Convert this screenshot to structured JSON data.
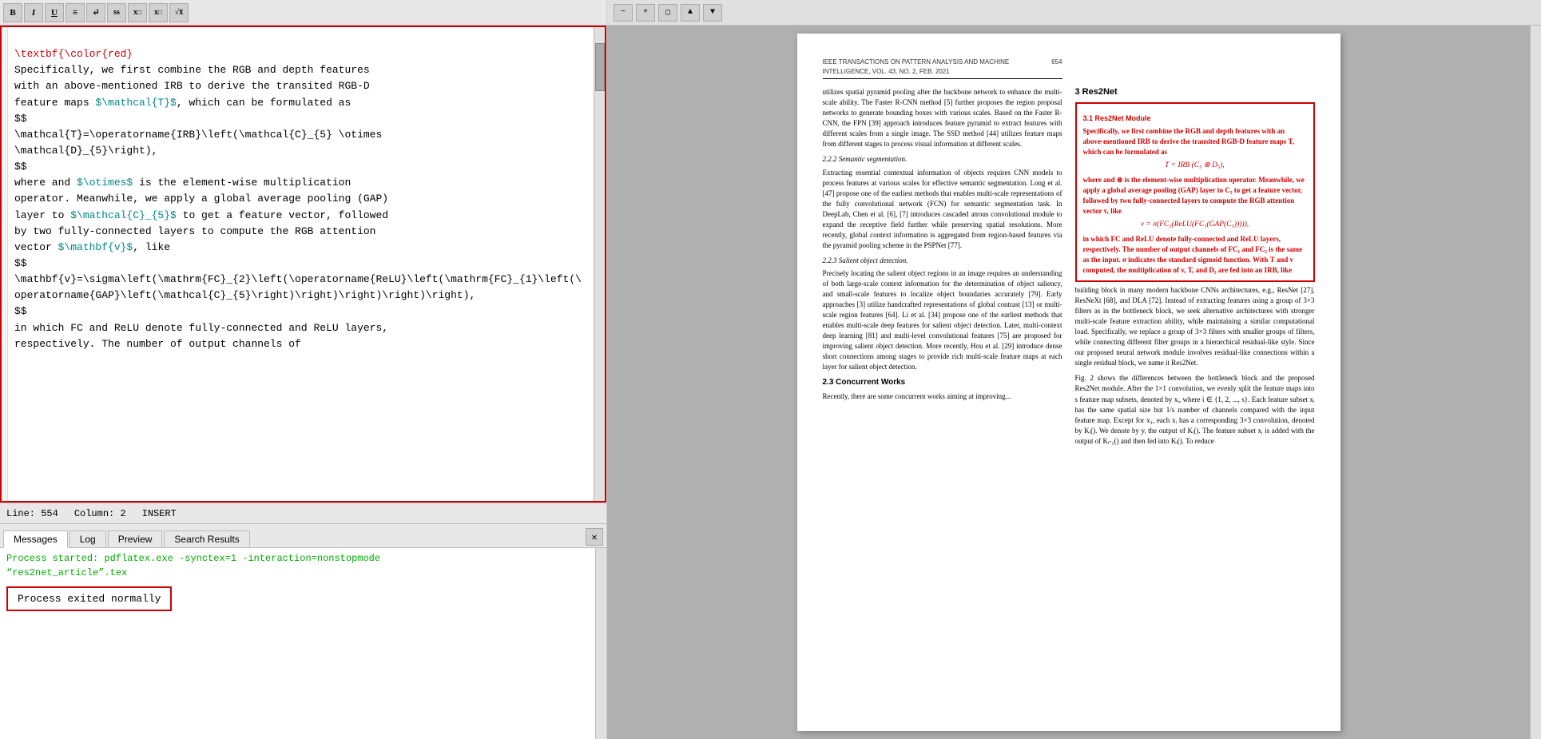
{
  "editor": {
    "toolbar_buttons": [
      "B",
      "I",
      "U",
      "align",
      "enter",
      "ss",
      "x_sub",
      "x_sup",
      "fx"
    ],
    "content_lines": [
      {
        "type": "keyword-red",
        "text": "\\textbf{\\color{red}"
      },
      {
        "type": "normal",
        "text": "Specifically, we first combine the RGB and depth features"
      },
      {
        "type": "normal",
        "text": "with an above-mentioned IRB to derive the transited RGB-D"
      },
      {
        "type": "normal",
        "text": "feature maps "
      },
      {
        "type": "inline",
        "parts": [
          {
            "type": "normal",
            "text": "feature maps "
          },
          {
            "type": "cyan",
            "text": "$\\mathcal{T}$"
          },
          {
            "type": "normal",
            "text": ", which can be formulated as"
          }
        ]
      },
      {
        "type": "normal",
        "text": "$$"
      },
      {
        "type": "normal",
        "text": "\\mathcal{T}=\\operatorname{IRB}\\left(\\mathcal{C}_{5} \\otimes"
      },
      {
        "type": "normal",
        "text": "\\mathcal{D}_{5}\\right),"
      },
      {
        "type": "normal",
        "text": "$$"
      },
      {
        "type": "normal",
        "text": "where and "
      },
      {
        "type": "inline2",
        "text": "where and $\\otimes$ is the element-wise multiplication"
      },
      {
        "type": "normal",
        "text": "operator. Meanwhile, we apply a global average pooling (GAP)"
      },
      {
        "type": "inline3",
        "text": "layer to $\\mathcal{C}_{5}$ to get a feature vector, followed"
      },
      {
        "type": "normal",
        "text": "by two fully-connected layers to compute the RGB attention"
      },
      {
        "type": "inline4",
        "text": "vector $\\mathbf{v}$, like"
      },
      {
        "type": "normal",
        "text": "$$"
      },
      {
        "type": "normal",
        "text": "\\mathbf{v}=\\sigma\\left(\\mathrm{FC}_{2}\\left(\\operatorname{ReLU}\\left(\\mathrm{FC}_{1}\\left(\\operatorname{GAP}\\left(\\mathcal{C}_{5}\\right)\\right)\\right)\\right)\\right),"
      },
      {
        "type": "normal",
        "text": "$$"
      },
      {
        "type": "normal",
        "text": "in which FC and ReLU denote fully-connected and ReLU layers,"
      },
      {
        "type": "normal",
        "text": "respectively. The number of output channels of"
      }
    ],
    "status_line": "Line: 554    Column: 2         INSERT",
    "status_line_num": "Line: 554",
    "status_col": "Column: 2",
    "status_mode": "INSERT"
  },
  "messages_panel": {
    "tabs": [
      "Messages",
      "Log",
      "Preview",
      "Search Results"
    ],
    "active_tab": "Messages",
    "process_line1": "Process started: pdflatex.exe -synctex=1 -interaction=nonstopmode",
    "process_line2": "“res2net_article”.tex",
    "exited_text": "Process exited normally"
  },
  "pdf": {
    "header_left": "IEEE TRANSACTIONS ON PATTERN ANALYSIS AND MACHINE INTELLIGENCE, VOL. 43, NO. 2, FEB. 2021",
    "header_right": "654",
    "section_title": "3  Res2Net",
    "subsection_title": "3.1  Res2Net Module",
    "highlight_bold": "Specifically, we first combine the RGB and depth features with an above-mentioned IRB to derive the transited RGB-D feature maps Τ, which can be formulated as",
    "math_formula": "Τ = IRB (C₅ ⊗ D₅),",
    "highlight_bold2": "where and ⊗ is the element-wise multiplication operator. Meanwhile, we apply a global average pooling (GAP) layer to C₅ to get a feature vector, followed by two fully-connected layers to compute the RGB attention vector v, like",
    "math_formula2": "v = σ(FC₂(ReLU(FC₁(GAP(C₅))))),",
    "highlight_bold3": "in which FC and ReLU denote fully-connected and ReLU layers, respectively. The number of output channels of FC₁ and FC₂ is the same as the input. σ indicates the standard sigmoid function. With Τ and v computed, the multiplication of v, Τ, and D₅ are fed into an IRB, like",
    "left_col_p1": "utilizes spatial pyramid pooling after the backbone network to enhance the multi-scale ability. The Faster R-CNN method [5] further proposes the region proposal networks to generate bounding boxes with various scales. Based on the Faster R-CNN, the FPN [39] approach introduces feature pyramid to extract features with different scales from a single image. The SSD method [44] utilizes feature maps from different stages to process visual information at different scales.",
    "left_subsec": "2.2.2  Semantic segmentation.",
    "left_col_p2": "Extracting essential contextual information of objects requires CNN models to process features at various scales for effective semantic segmentation. Long et al. [47] propose one of the earliest methods that enables multi-scale representations of the fully convolutional network (FCN) for semantic segmentation task. In DeepLab, Chen et al. [6], [7] introduces cascaded atrous convolutional module to expand the receptive field further while preserving spatial resolutions. More recently, global context information is aggregated from region-based features via the pyramid pooling scheme in the PSPNet [77].",
    "left_subsec2": "2.2.3  Salient object detection.",
    "left_col_p3": "Precisely locating the salient object regions in an image requires an understanding of both large-scale context information for the determination of object saliency, and small-scale features to localize object boundaries accurately [79]. Early approaches [3] utilize handcrafted representations of global contrast [13] or multi-scale region features [64]. Li et al. [34] propose one of the earliest methods that enables multi-scale deep features for salient object detection. Later, multi-context deep learning [81] and multi-level convolutional features [75] are proposed for improving salient object detection. More recently, Hou et al. [29] introduce dense short connections among stages to provide rich multi-scale feature maps at each layer for salient object detection.",
    "left_sec3": "2.3  Concurrent Works",
    "left_col_p4": "Recently, there are some concurrent works aiming at improving...",
    "right_p1": "building block in many modern backbone CNNs architectures, e.g., ResNet [27], ResNeXt [68], and DLA [72]. Instead of extracting features using a group of 3×3 filters as in the bottleneck block, we seek alternative architectures with stronger multi-scale feature extraction ability, while maintaining a similar computational load. Specifically, we replace a group of 3×3 filters with smaller groups of filters, while connecting different filter groups in a hierarchical residual-like style. Since our proposed neural network module involves residual-like connections within a single residual block, we name it Res2Net.",
    "right_p2": "Fig. 2 shows the differences between the bottleneck block and the proposed Res2Net module. After the 1×1 convolution, we evenly split the feature maps into s feature map subsets, denoted by xᵢ, where i ∈ {1, 2, ..., s}. Each feature subset xᵢ has the same spatial size but 1/s number of channels compared with the input feature map. Except for x₁, each xᵢ has a corresponding 3×3 convolution, denoted by Kᵢ(). We denote by yᵢ the output of Kᵢ(). The feature subset xᵢ is added with the output of Kᵢ-₁() and then fed into Kᵢ(). To reduce"
  }
}
